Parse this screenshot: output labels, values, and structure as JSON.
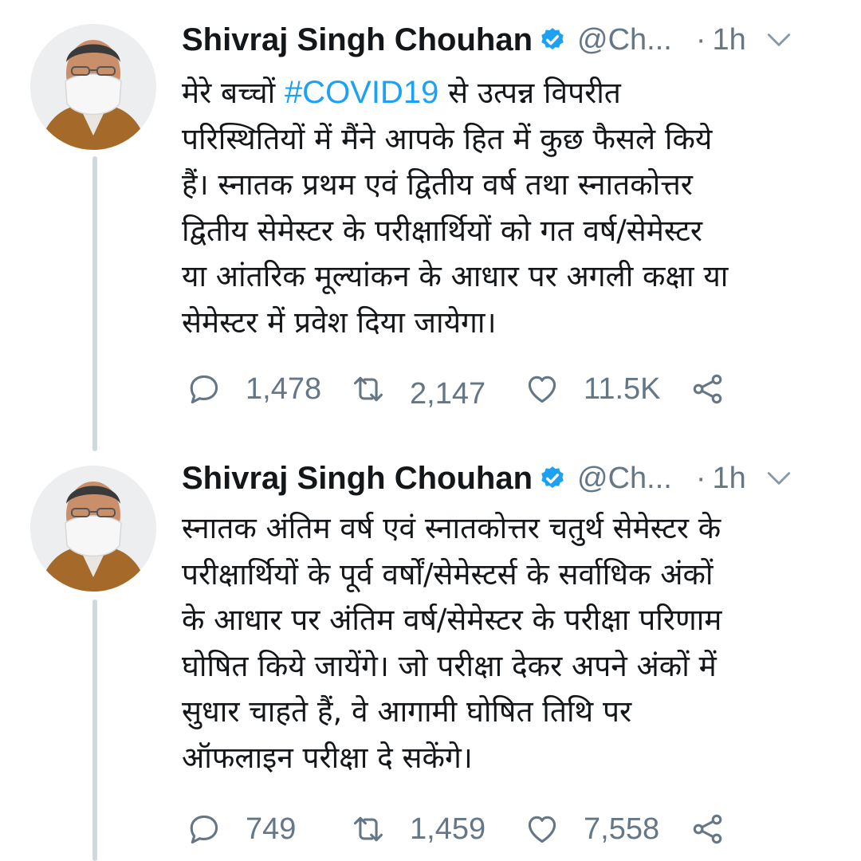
{
  "tweets": [
    {
      "author_name": "Shivraj Singh Chouhan",
      "handle": "@Ch...",
      "separator": "·",
      "time": "1h",
      "text_lines": [
        [
          "मेरे बच्चों ",
          "#COVID19",
          " से उत्पन्न विपरीत"
        ],
        "परिस्थितियों में मैंने आपके हित में कुछ फैसले किये",
        "हैं। स्नातक प्रथम एवं द्वितीय वर्ष तथा स्नातकोत्तर",
        "द्वितीय सेमेस्टर के परीक्षार्थियों को गत वर्ष/सेमेस्टर",
        "या आंतरिक मूल्यांकन के आधार पर अगली कक्षा या",
        "सेमेस्टर में प्रवेश दिया जायेगा।"
      ],
      "hashtag": "#COVID19",
      "replies": "1,478",
      "retweets": "2,147",
      "likes": "11.5K"
    },
    {
      "author_name": "Shivraj Singh Chouhan",
      "handle": "@Ch...",
      "separator": "·",
      "time": "1h",
      "text_lines": [
        "स्नातक अंतिम वर्ष एवं स्नातकोत्तर चतुर्थ सेमेस्टर के",
        "परीक्षार्थियों के पूर्व वर्षों/सेमेस्टर्स के सर्वाधिक अंकों",
        "के आधार पर अंतिम वर्ष/सेमेस्टर के परीक्षा परिणाम",
        "घोषित किये जायेंगे। जो परीक्षा देकर अपने अंकों में",
        "सुधार चाहते हैं, वे आगामी घोषित तिथि पर",
        "ऑफलाइन परीक्षा दे सकेंगे।"
      ],
      "replies": "749",
      "retweets": "1,459",
      "likes": "7,558"
    }
  ],
  "icons": {
    "verified": "verified-badge-icon",
    "caret": "chevron-down-icon",
    "reply": "reply-icon",
    "retweet": "retweet-icon",
    "like": "heart-icon",
    "share": "share-icon"
  },
  "colors": {
    "text": "#14171a",
    "secondary": "#657786",
    "link": "#1da1f2",
    "thread_line": "#cfd9de",
    "verified": "#1da1f2"
  }
}
